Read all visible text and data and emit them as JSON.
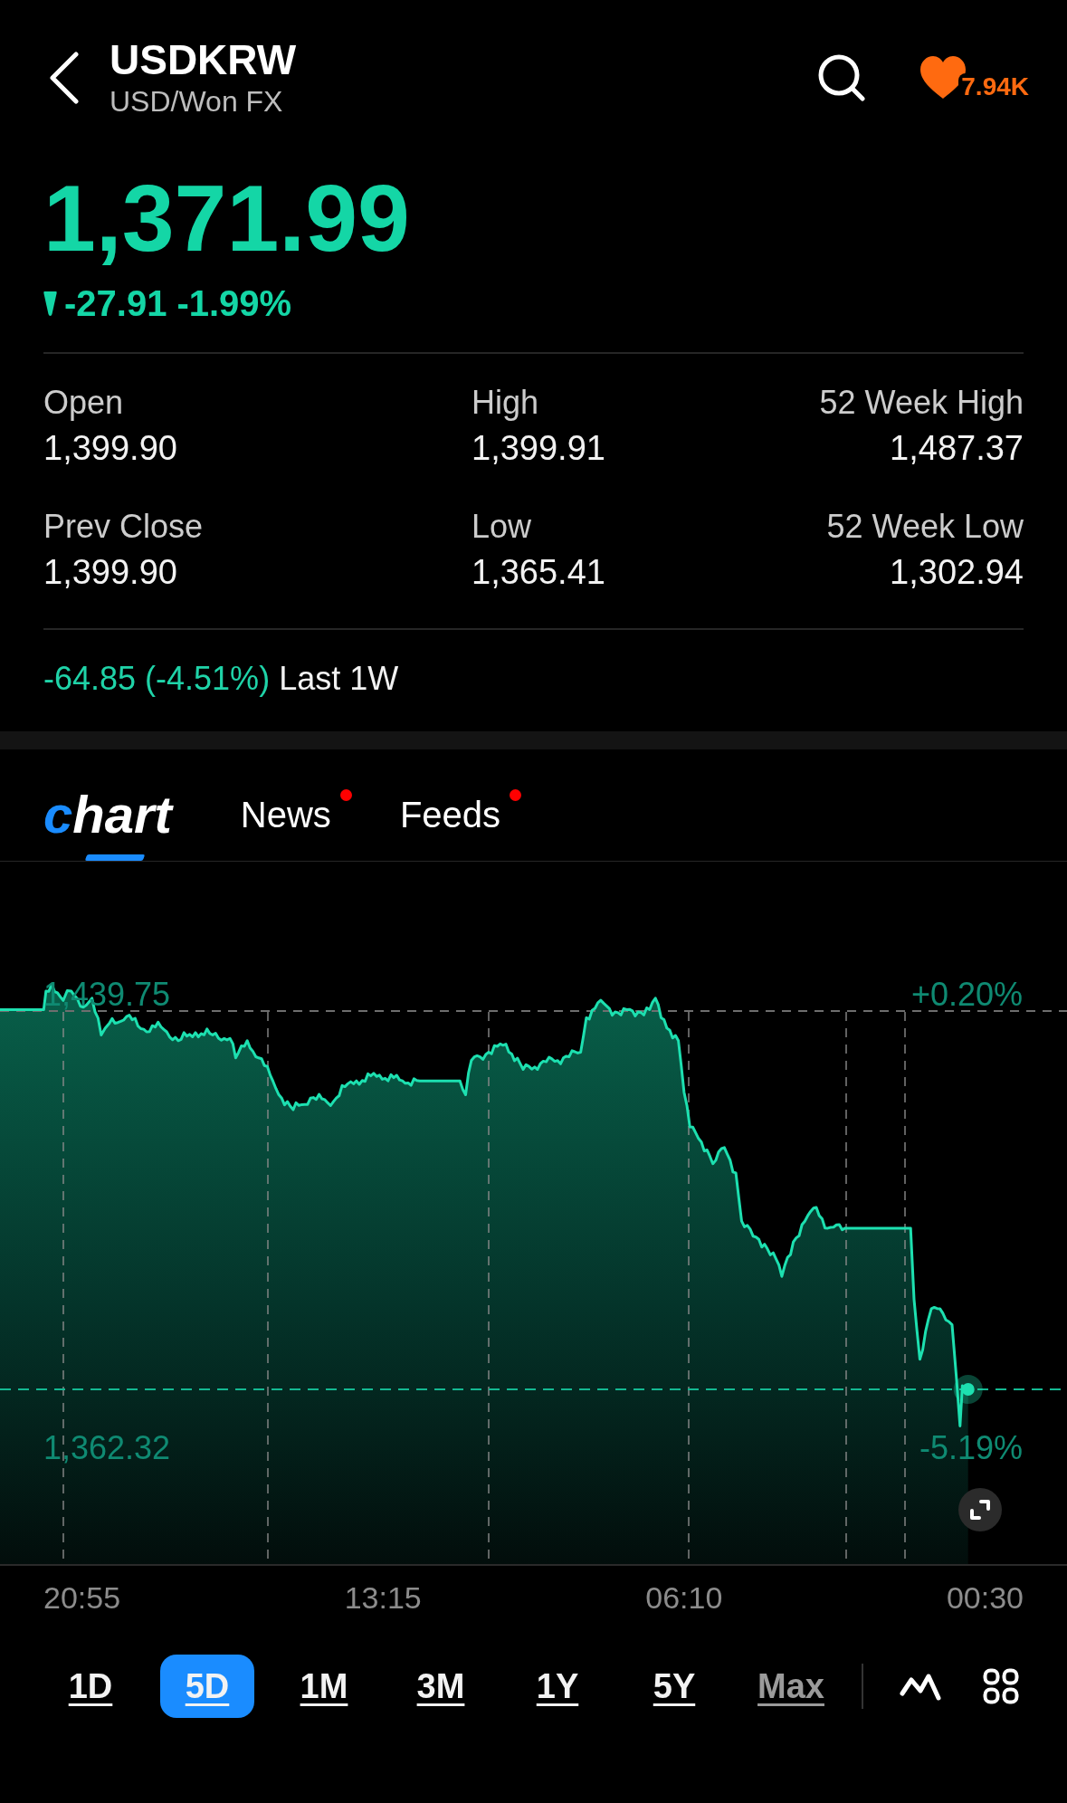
{
  "header": {
    "title": "USDKRW",
    "subtitle": "USD/Won FX",
    "watchers": "7.94K"
  },
  "quote": {
    "price": "1,371.99",
    "falling": true,
    "change": "-27.91",
    "change_percent": "-1.99%"
  },
  "stats": [
    {
      "label": "Open",
      "value": "1,399.90"
    },
    {
      "label": "High",
      "value": "1,399.91"
    },
    {
      "label": "52 Week High",
      "value": "1,487.37"
    },
    {
      "label": "Prev Close",
      "value": "1,399.90"
    },
    {
      "label": "Low",
      "value": "1,365.41"
    },
    {
      "label": "52 Week Low",
      "value": "1,302.94"
    }
  ],
  "period_change": {
    "change": "-64.85 (-4.51%)",
    "period": "Last 1W"
  },
  "tabs": [
    {
      "label": "chart",
      "kind": "logo",
      "selected": true,
      "unread": false
    },
    {
      "label": "News",
      "kind": "text",
      "selected": false,
      "unread": true
    },
    {
      "label": "Feeds",
      "kind": "text",
      "selected": false,
      "unread": true
    }
  ],
  "chart": {
    "top_price": "1,439.75",
    "top_percent": "+0.20%",
    "low_price": "1,362.32",
    "low_percent": "-5.19%",
    "time_labels": [
      "20:55",
      "13:15",
      "06:10",
      "00:30"
    ]
  },
  "ranges": [
    {
      "label": "1D",
      "selected": false,
      "faded": false
    },
    {
      "label": "5D",
      "selected": true,
      "faded": false
    },
    {
      "label": "1M",
      "selected": false,
      "faded": false
    },
    {
      "label": "3M",
      "selected": false,
      "faded": false
    },
    {
      "label": "1Y",
      "selected": false,
      "faded": false
    },
    {
      "label": "5Y",
      "selected": false,
      "faded": false
    },
    {
      "label": "Max",
      "selected": false,
      "faded": true
    }
  ]
}
